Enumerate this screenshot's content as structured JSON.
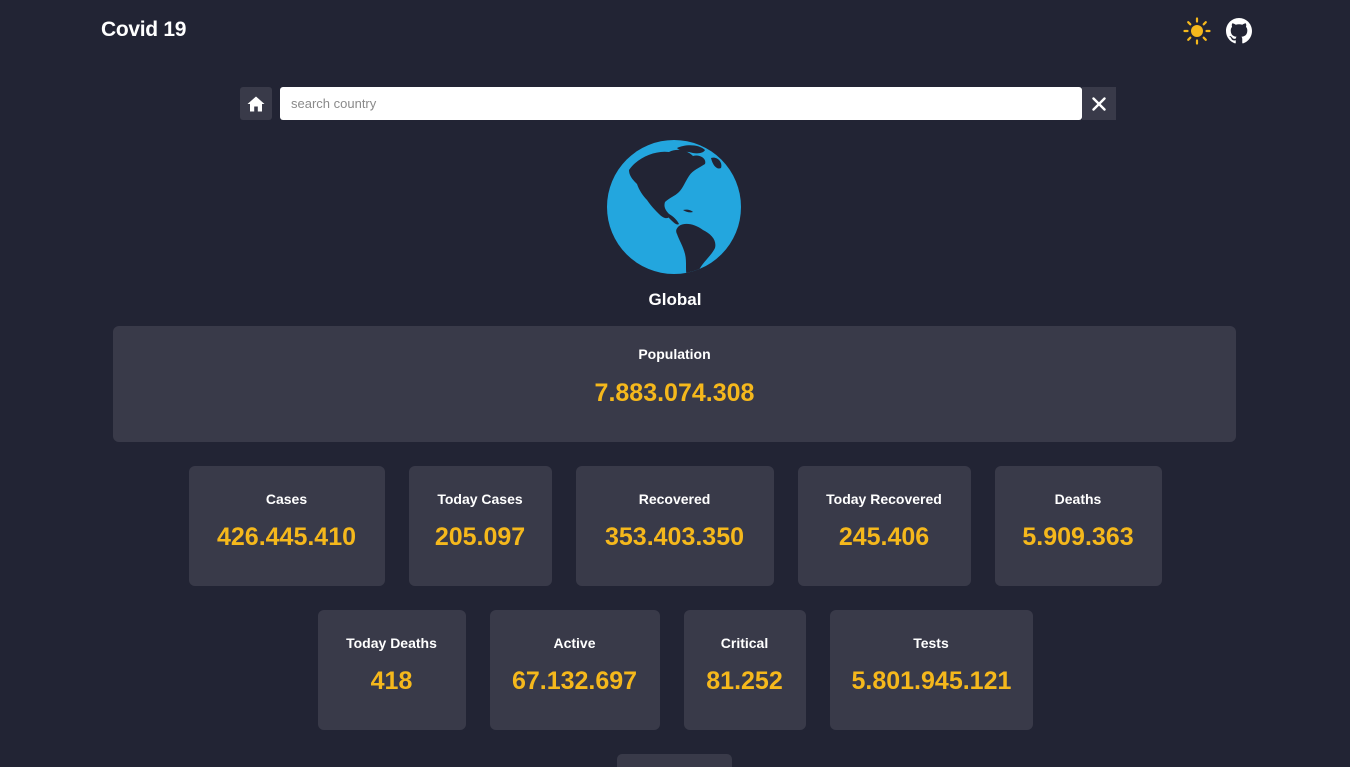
{
  "header": {
    "brand": "Covid 19",
    "theme_icon": "sun-icon",
    "github_icon": "github-icon",
    "accent_color": "#f5b81c"
  },
  "search": {
    "home_icon": "home-icon",
    "placeholder": "search country",
    "value": "",
    "clear_icon": "close-icon"
  },
  "location": {
    "name": "Global",
    "image": "globe-icon"
  },
  "population": {
    "label": "Population",
    "value": "7.883.074.308"
  },
  "stats_row1": [
    {
      "label": "Cases",
      "value": "426.445.410"
    },
    {
      "label": "Today Cases",
      "value": "205.097"
    },
    {
      "label": "Recovered",
      "value": "353.403.350"
    },
    {
      "label": "Today Recovered",
      "value": "245.406"
    },
    {
      "label": "Deaths",
      "value": "5.909.363"
    }
  ],
  "stats_row2": [
    {
      "label": "Today Deaths",
      "value": "418"
    },
    {
      "label": "Active",
      "value": "67.132.697"
    },
    {
      "label": "Critical",
      "value": "81.252"
    },
    {
      "label": "Tests",
      "value": "5.801.945.121"
    }
  ]
}
